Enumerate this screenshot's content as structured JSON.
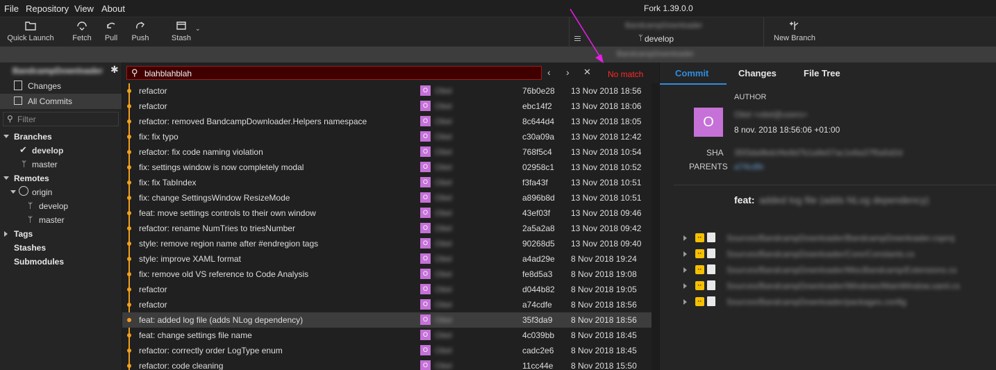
{
  "menu": [
    "File",
    "Repository",
    "View",
    "About"
  ],
  "app_title": "Fork 1.39.0.0",
  "toolbar": {
    "quick_launch": "Quick Launch",
    "fetch": "Fetch",
    "pull": "Pull",
    "push": "Push",
    "stash": "Stash",
    "repo_name": "BandcampDownloader",
    "branch": "develop",
    "new_branch": "New Branch"
  },
  "tab": {
    "label": "BandcampDownloader"
  },
  "sidebar": {
    "repo_name": "BandcampDownloader",
    "changes": "Changes",
    "all_commits": "All Commits",
    "filter_placeholder": "Filter",
    "branches_header": "Branches",
    "branches": [
      "develop",
      "master"
    ],
    "remotes_header": "Remotes",
    "remote_name": "origin",
    "remote_branches": [
      "develop",
      "master"
    ],
    "tags_header": "Tags",
    "stashes_header": "Stashes",
    "submodules_header": "Submodules"
  },
  "search": {
    "value": "blahblahblah",
    "status": "No match"
  },
  "commits": [
    {
      "message": "refactor",
      "initial": "O",
      "author": "Otiel",
      "sha": "76b0e28",
      "date": "13 Nov 2018 18:56"
    },
    {
      "message": "refactor",
      "initial": "O",
      "author": "Otiel",
      "sha": "ebc14f2",
      "date": "13 Nov 2018 18:06"
    },
    {
      "message": "refactor: removed BandcampDownloader.Helpers namespace",
      "initial": "O",
      "author": "Otiel",
      "sha": "8c644d4",
      "date": "13 Nov 2018 18:05"
    },
    {
      "message": "fix: fix typo",
      "initial": "O",
      "author": "Otiel",
      "sha": "c30a09a",
      "date": "13 Nov 2018 12:42"
    },
    {
      "message": "refactor: fix code naming violation",
      "initial": "O",
      "author": "Otiel",
      "sha": "768f5c4",
      "date": "13 Nov 2018 10:54"
    },
    {
      "message": "fix: settings window is now completely modal",
      "initial": "O",
      "author": "Otiel",
      "sha": "02958c1",
      "date": "13 Nov 2018 10:52"
    },
    {
      "message": "fix: fix TabIndex",
      "initial": "O",
      "author": "Otiel",
      "sha": "f3fa43f",
      "date": "13 Nov 2018 10:51"
    },
    {
      "message": "fix: change SettingsWindow ResizeMode",
      "initial": "O",
      "author": "Otiel",
      "sha": "a896b8d",
      "date": "13 Nov 2018 10:51"
    },
    {
      "message": "feat: move settings controls to their own window",
      "initial": "O",
      "author": "Otiel",
      "sha": "43ef03f",
      "date": "13 Nov 2018 09:46"
    },
    {
      "message": "refactor: rename NumTries to triesNumber",
      "initial": "O",
      "author": "Otiel",
      "sha": "2a5a2a8",
      "date": "13 Nov 2018 09:42"
    },
    {
      "message": "style: remove region name after #endregion tags",
      "initial": "O",
      "author": "Otiel",
      "sha": "90268d5",
      "date": "13 Nov 2018 09:40"
    },
    {
      "message": "style: improve XAML format",
      "initial": "O",
      "author": "Otiel",
      "sha": "a4ad29e",
      "date": "8 Nov 2018 19:24"
    },
    {
      "message": "fix: remove old VS reference to Code Analysis",
      "initial": "O",
      "author": "Otiel",
      "sha": "fe8d5a3",
      "date": "8 Nov 2018 19:08"
    },
    {
      "message": "refactor",
      "initial": "O",
      "author": "Otiel",
      "sha": "d044b82",
      "date": "8 Nov 2018 19:05"
    },
    {
      "message": "refactor",
      "initial": "O",
      "author": "Otiel",
      "sha": "a74cdfe",
      "date": "8 Nov 2018 18:56"
    },
    {
      "message": "feat: added log file (adds NLog dependency)",
      "initial": "O",
      "author": "Otiel",
      "sha": "35f3da9",
      "date": "8 Nov 2018 18:56",
      "selected": true
    },
    {
      "message": "feat: change settings file name",
      "initial": "O",
      "author": "Otiel",
      "sha": "4c039bb",
      "date": "8 Nov 2018 18:45"
    },
    {
      "message": "refactor: correctly order LogType enum",
      "initial": "O",
      "author": "Otiel",
      "sha": "cadc2e6",
      "date": "8 Nov 2018 18:45"
    },
    {
      "message": "refactor: code cleaning",
      "initial": "O",
      "author": "Otiel",
      "sha": "11cc44e",
      "date": "8 Nov 2018 15:50"
    }
  ],
  "details": {
    "tabs": [
      "Commit",
      "Changes",
      "File Tree"
    ],
    "author_label": "AUTHOR",
    "avatar_initial": "O",
    "author_name": "Otiel <otiel@users>",
    "date": "8 nov. 2018 18:56:06 +01:00",
    "sha_label": "SHA",
    "sha_value": "35f3da9bdcf4e8d7b1a9e07ac1e6a37f5a5d2d",
    "parents_label": "PARENTS",
    "parents_value": "a74cdfe",
    "subject_prefix": "feat:",
    "subject_rest": "added log file (adds NLog dependency)",
    "files": [
      "Sources/BandcampDownloader/BandcampDownloader.csproj",
      "Sources/BandcampDownloader/Core/Constants.cs",
      "Sources/BandcampDownloader/MiscBandcamp/Extensions.cs",
      "Sources/BandcampDownloader/Windows/MainWindow.xaml.cs",
      "Sources/BandcampDownloader/packages.config"
    ]
  },
  "colors": {
    "accent": "#2f8ee0",
    "graph": "#f0a01e",
    "avatar": "#c571d8",
    "no_match": "#ff2a2a",
    "annotation_arrow": "#e61ee6"
  }
}
